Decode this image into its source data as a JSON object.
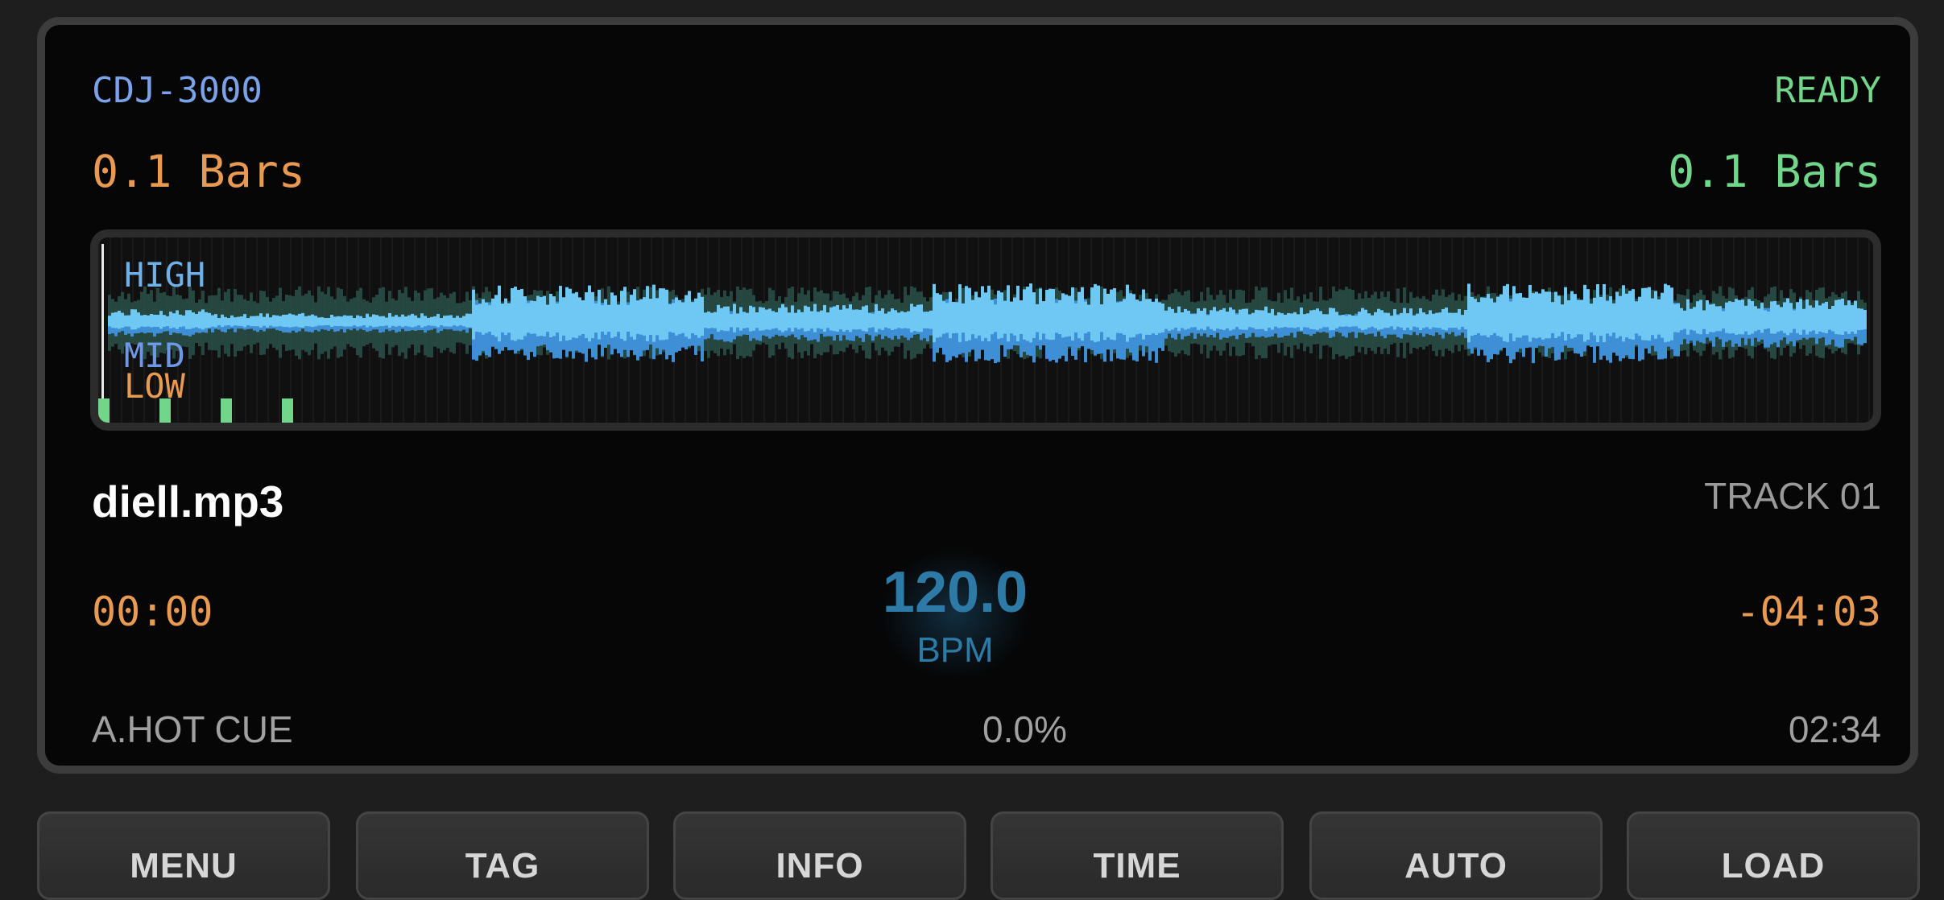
{
  "header": {
    "model": "CDJ-3000",
    "status": "READY"
  },
  "bars": {
    "left": "0.1 Bars",
    "right": "0.1 Bars"
  },
  "waveform": {
    "bands": {
      "high": "HIGH",
      "mid": "MID",
      "low": "LOW"
    },
    "colors": {
      "high": "#6fc8f4",
      "mid": "#3f8fd6",
      "bg_band": "#2c5a50",
      "beat_marker": "#71d58a"
    }
  },
  "track": {
    "name": "diell.mp3",
    "number": "TRACK 01"
  },
  "time": {
    "elapsed": "00:00",
    "remaining": "-04:03",
    "total": "02:34"
  },
  "tempo": {
    "bpm": "120.0",
    "bpm_label": "BPM",
    "pitch": "0.0%"
  },
  "cue_mode": "A.HOT CUE",
  "buttons": [
    {
      "label": "MENU"
    },
    {
      "label": "TAG"
    },
    {
      "label": "INFO"
    },
    {
      "label": "TIME"
    },
    {
      "label": "AUTO"
    },
    {
      "label": "LOAD"
    }
  ],
  "colors": {
    "accent_orange": "#e89a52",
    "accent_green": "#71d58a",
    "accent_blue": "#7aa2e8"
  }
}
